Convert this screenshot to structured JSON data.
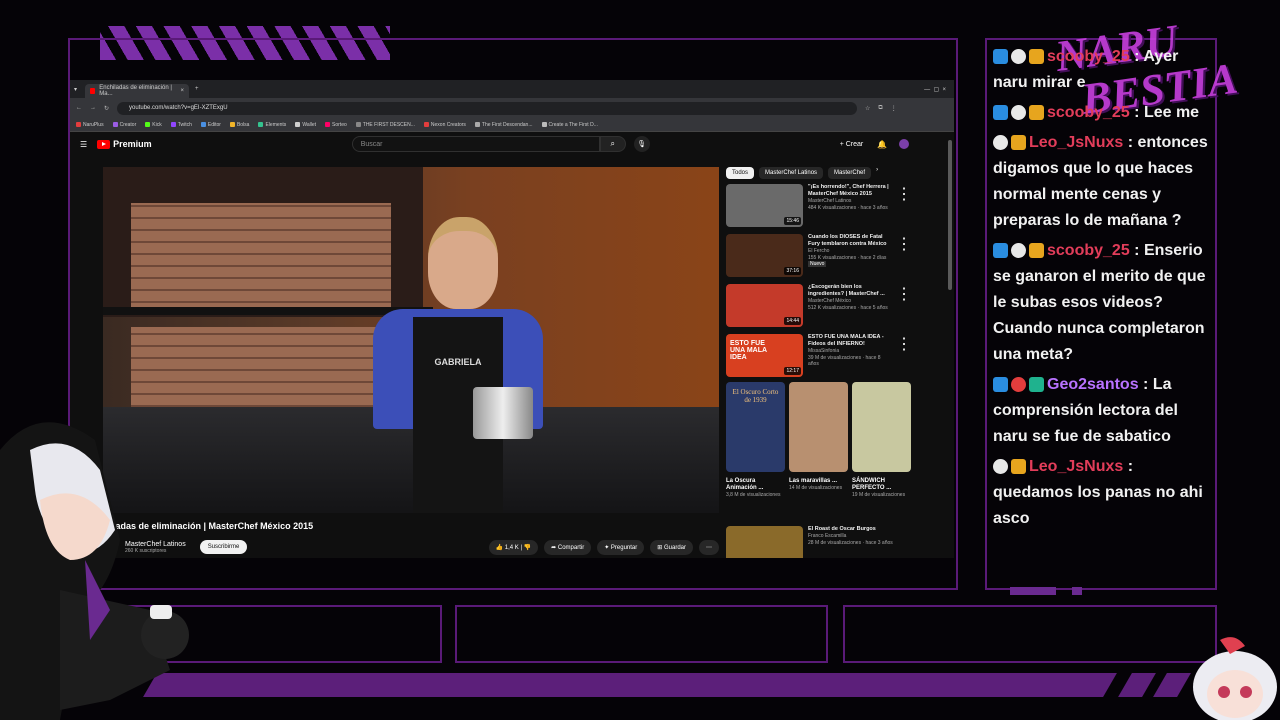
{
  "browser": {
    "tab_title": "Enchiladas de eliminación | Ma...",
    "url": "youtube.com/watch?v=gEI-XZTExgU",
    "bookmarks": [
      "NaruPlus",
      "Creator",
      "Kick",
      "Twitch",
      "Editor",
      "Bolsa",
      "Elements",
      "Wallet",
      "Sorteo",
      "THE FIRST DESCEN...",
      "Nexon Creators",
      "The First Descendan...",
      "Create a The First D..."
    ]
  },
  "youtube": {
    "logo": "Premium",
    "search_placeholder": "Buscar",
    "create_label": "Crear",
    "video_title": "...iladas de eliminación | MasterChef México 2015",
    "channel_name": "MasterChef Latinos",
    "subscribers": "260 K suscriptores",
    "subscribe_label": "Suscribirme",
    "likes": "1,4 K",
    "share_label": "Compartir",
    "ask_label": "Preguntar",
    "save_label": "Guardar",
    "apron_name": "GABRIELA",
    "chips": [
      "Todos",
      "MasterChef Latinos",
      "MasterChef"
    ],
    "recommendations": [
      {
        "title": "\"¡Es horrendo!\", Chef Herrera | MasterChef México 2015",
        "channel": "MasterChef Latinos",
        "meta": "484 K visualizaciones · hace 3 años",
        "duration": "15:46",
        "color": "#6a6a6a"
      },
      {
        "title": "Cuando los DIOSES de Fatal Fury temblaron contra México",
        "channel": "El Fercho",
        "meta": "155 K visualizaciones · hace 2 días",
        "badge": "Nuevo",
        "duration": "37:16",
        "color": "#4a2a1a"
      },
      {
        "title": "¿Escogerán bien los ingredientes? | MasterChef ...",
        "channel": "MasterChef México",
        "meta": "512 K visualizaciones · hace 5 años",
        "duration": "14:44",
        "color": "#c43a2a"
      },
      {
        "title": "ESTO FUE UNA MALA IDEA - Fideos del INFIERNO!",
        "channel": "MissaSinfonia",
        "meta": "39 M de visualizaciones · hace 8 años",
        "duration": "12:17",
        "color": "#d84020",
        "thumb_text": "ESTO FUE UNA MALA IDEA"
      }
    ],
    "shorts": [
      {
        "title": "La Oscura Animación ...",
        "meta": "3,8 M de visualizaciones",
        "color": "#2a3a6a",
        "thumb_text": "El Oscuro Corto de 1939"
      },
      {
        "title": "Las maravillas ...",
        "meta": "14 M de visualizaciones",
        "color": "#b89070"
      },
      {
        "title": "SÁNDWICH PERFECTO ...",
        "meta": "19 M de visualizaciones",
        "color": "#c8c8a0"
      }
    ],
    "last_rec": {
      "title": "El Roast de Oscar Burgos",
      "channel": "Franco Escamilla",
      "meta": "28 M de visualizaciones · hace 3 años",
      "color": "#8a6a2a"
    }
  },
  "chat": {
    "messages": [
      {
        "user": "scooby_25",
        "user_color": "#e23d5a",
        "badges": [
          "blue",
          "white",
          "gold"
        ],
        "text": "Ayer naru mirar e"
      },
      {
        "user": "scooby_25",
        "user_color": "#e23d5a",
        "badges": [
          "blue",
          "white",
          "gold"
        ],
        "text": "Lee me"
      },
      {
        "user": "Leo_JsNuxs",
        "user_color": "#e23d5a",
        "badges": [
          "white",
          "gold"
        ],
        "text": "entonces digamos que lo que haces normal mente cenas y preparas lo de mañana ?"
      },
      {
        "user": "scooby_25",
        "user_color": "#e23d5a",
        "badges": [
          "blue",
          "white",
          "gold"
        ],
        "text": "Enserio se ganaron el merito de que le subas esos videos? Cuando nunca completaron una meta?"
      },
      {
        "user": "Geo2santos",
        "user_color": "#b872ff",
        "badges": [
          "blue",
          "red",
          "green"
        ],
        "text": "La comprensión lectora del naru se fue de sabatico"
      },
      {
        "user": "Leo_JsNuxs",
        "user_color": "#e23d5a",
        "badges": [
          "white",
          "gold"
        ],
        "text": "quedamos los panas no ahi asco"
      }
    ]
  },
  "overlay": {
    "brand_line1": "NARU",
    "brand_line2": "BESTIA"
  },
  "colors": {
    "frame": "#5a1a78",
    "accent": "#7b2fa8"
  }
}
